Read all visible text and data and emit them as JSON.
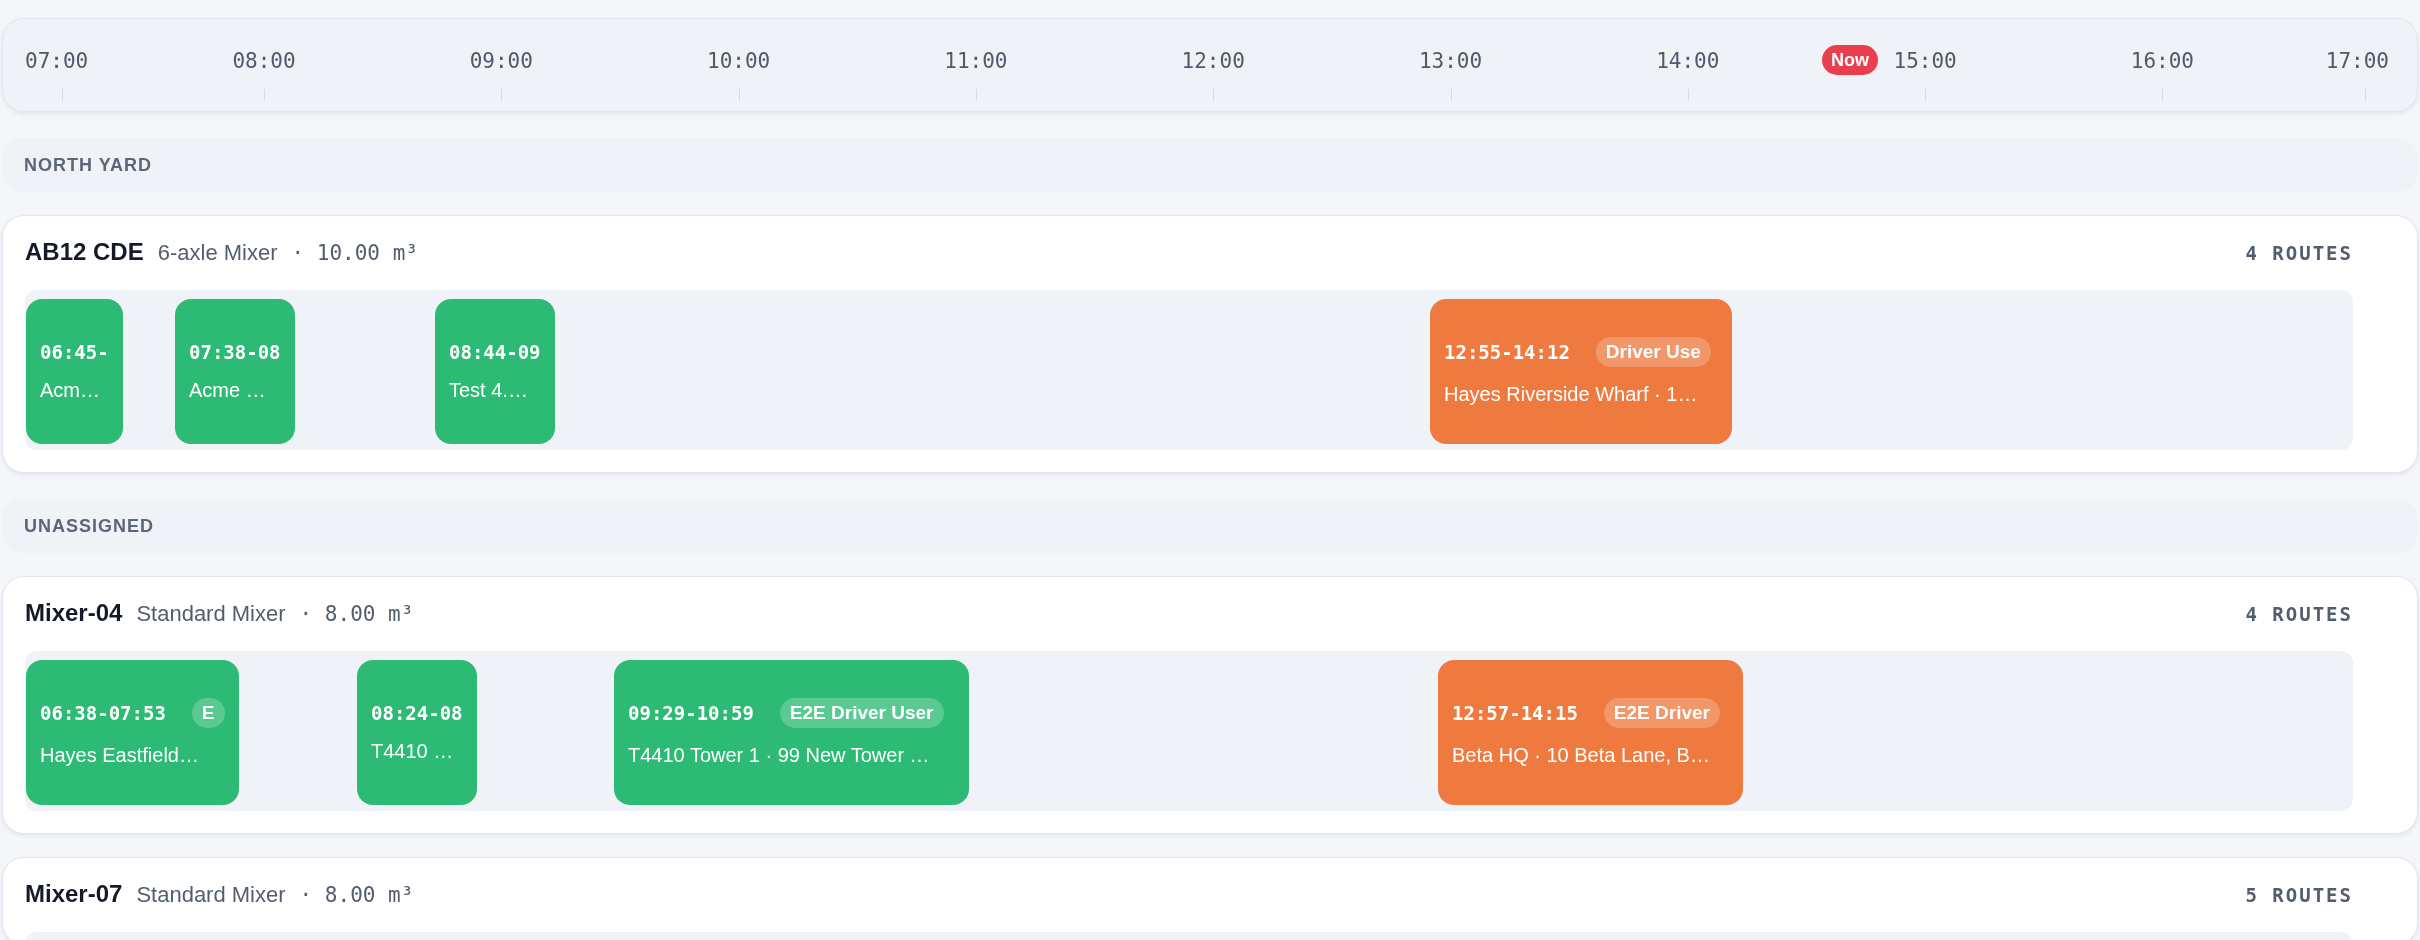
{
  "timeline": {
    "hours": [
      "07:00",
      "08:00",
      "09:00",
      "10:00",
      "11:00",
      "12:00",
      "13:00",
      "14:00",
      "15:00",
      "16:00",
      "17:00"
    ],
    "now_label": "Now"
  },
  "groups": [
    {
      "title": "NORTH YARD",
      "vehicles": [
        {
          "name": "AB12 CDE",
          "type": "6-axle Mixer",
          "capacity": "· 10.00 m³",
          "route_count": "4 ROUTES",
          "routes": [
            {
              "time": "06:45-",
              "place": "Acm…",
              "color": "#2dba74"
            },
            {
              "time": "07:38-08",
              "place": "Acme …",
              "color": "#2dba74"
            },
            {
              "time": "08:44-09",
              "place": "Test 4.…",
              "color": "#2dba74"
            },
            {
              "time": "12:55-14:12",
              "badge": "Driver Use",
              "place": "Hayes Riverside Wharf · 1…",
              "color": "#ee7a40"
            }
          ]
        }
      ]
    },
    {
      "title": "UNASSIGNED",
      "vehicles": [
        {
          "name": "Mixer-04",
          "type": "Standard Mixer",
          "capacity": "· 8.00 m³",
          "route_count": "4 ROUTES",
          "routes": [
            {
              "time": "06:38-07:53",
              "badge": "E",
              "place": "Hayes Eastfield…",
              "color": "#2dba74"
            },
            {
              "time": "08:24-08",
              "place": "T4410 …",
              "color": "#2dba74"
            },
            {
              "time": "09:29-10:59",
              "badge": "E2E Driver User",
              "place": "T4410 Tower 1 · 99 New Tower …",
              "color": "#2dba74"
            },
            {
              "time": "12:57-14:15",
              "badge": "E2E Driver",
              "place": "Beta HQ · 10 Beta Lane, B…",
              "color": "#ee7a40"
            }
          ]
        },
        {
          "name": "Mixer-07",
          "type": "Standard Mixer",
          "capacity": "· 8.00 m³",
          "route_count": "5 ROUTES"
        }
      ]
    }
  ]
}
